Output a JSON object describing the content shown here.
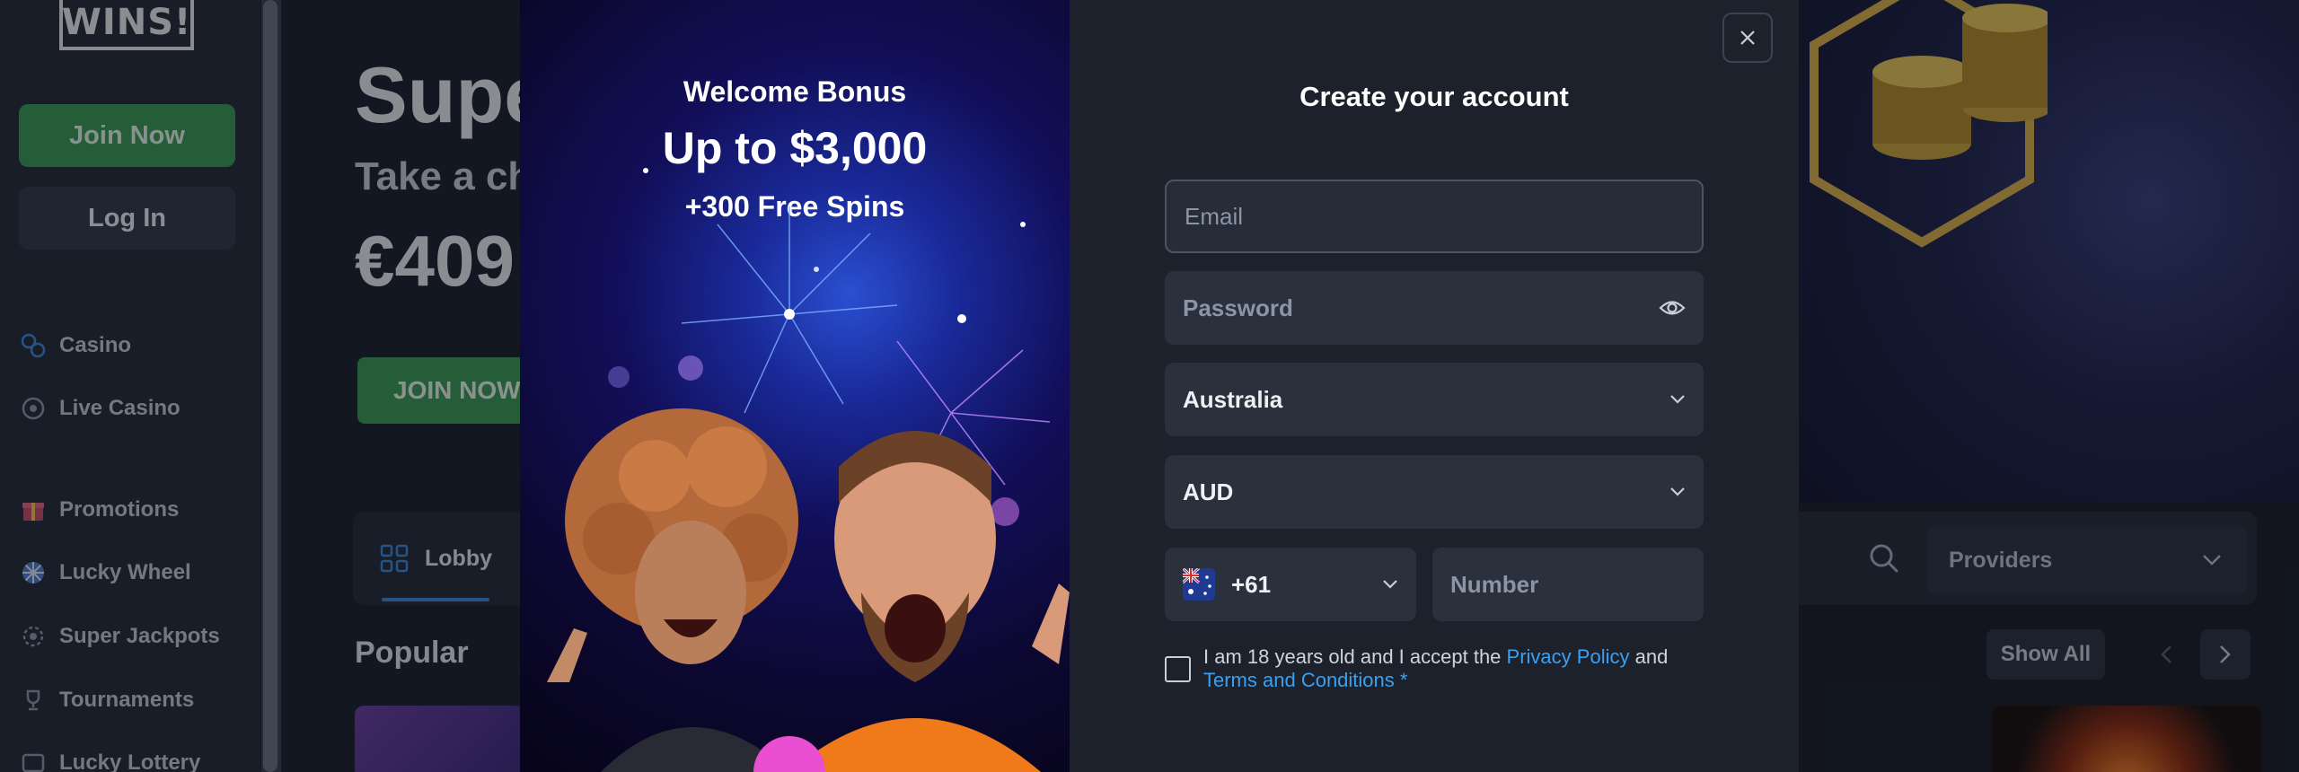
{
  "sidebar": {
    "logo_text": "WINS!",
    "join_label": "Join Now",
    "login_label": "Log In",
    "nav": [
      {
        "label": "Casino",
        "icon": "casino-icon"
      },
      {
        "label": "Live Casino",
        "icon": "live-casino-icon"
      },
      {
        "label": "Promotions",
        "icon": "gift-icon"
      },
      {
        "label": "Lucky Wheel",
        "icon": "wheel-icon"
      },
      {
        "label": "Super Jackpots",
        "icon": "jackpot-icon"
      },
      {
        "label": "Tournaments",
        "icon": "trophy-icon"
      },
      {
        "label": "Lucky Lottery",
        "icon": "lottery-icon"
      }
    ]
  },
  "hero": {
    "title": "Supe",
    "subtitle": "Take a ch",
    "amount": "€409",
    "join_label": "JOIN NOW"
  },
  "games": {
    "tab_lobby": "Lobby",
    "providers_label": "Providers",
    "section_title": "Popular",
    "show_all_label": "Show All"
  },
  "modal": {
    "promo": {
      "heading": "Welcome Bonus",
      "amount": "Up to $3,000",
      "spins": "+300 Free Spins"
    },
    "title": "Create your account",
    "email_placeholder": "Email",
    "password_placeholder": "Password",
    "country_value": "Australia",
    "currency_value": "AUD",
    "phone_code": "+61",
    "phone_placeholder": "Number",
    "consent_prefix": "I am 18 years old and I accept the",
    "privacy_link": "Privacy Policy",
    "consent_and": "and",
    "terms_link": "Terms and Conditions",
    "required_mark": "*"
  },
  "colors": {
    "accent_green": "#3a9a55",
    "link_blue": "#3aa0f2",
    "panel_bg": "#1c212b",
    "field_bg": "#2a303c"
  }
}
